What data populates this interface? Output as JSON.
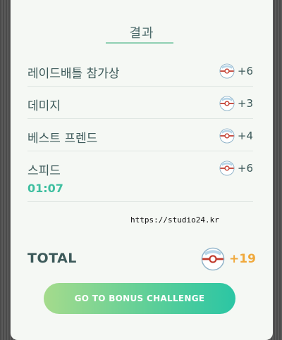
{
  "header": {
    "title": "결과"
  },
  "rows": [
    {
      "label": "레이드배틀 참가상",
      "value": "+6"
    },
    {
      "label": "데미지",
      "value": "+3"
    },
    {
      "label": "베스트 프렌드",
      "value": "+4"
    },
    {
      "label": "스피드",
      "value": "+6",
      "time": "01:07"
    }
  ],
  "watermark": "https://studio24.kr",
  "total": {
    "label": "TOTAL",
    "value": "+19"
  },
  "button": {
    "label": "GO TO BONUS CHALLENGE"
  },
  "icons": {
    "reward": "premier-ball-icon"
  },
  "colors": {
    "accent": "#3fbfa0",
    "total_value": "#f0a93c",
    "underline": "#8fd0b3"
  }
}
